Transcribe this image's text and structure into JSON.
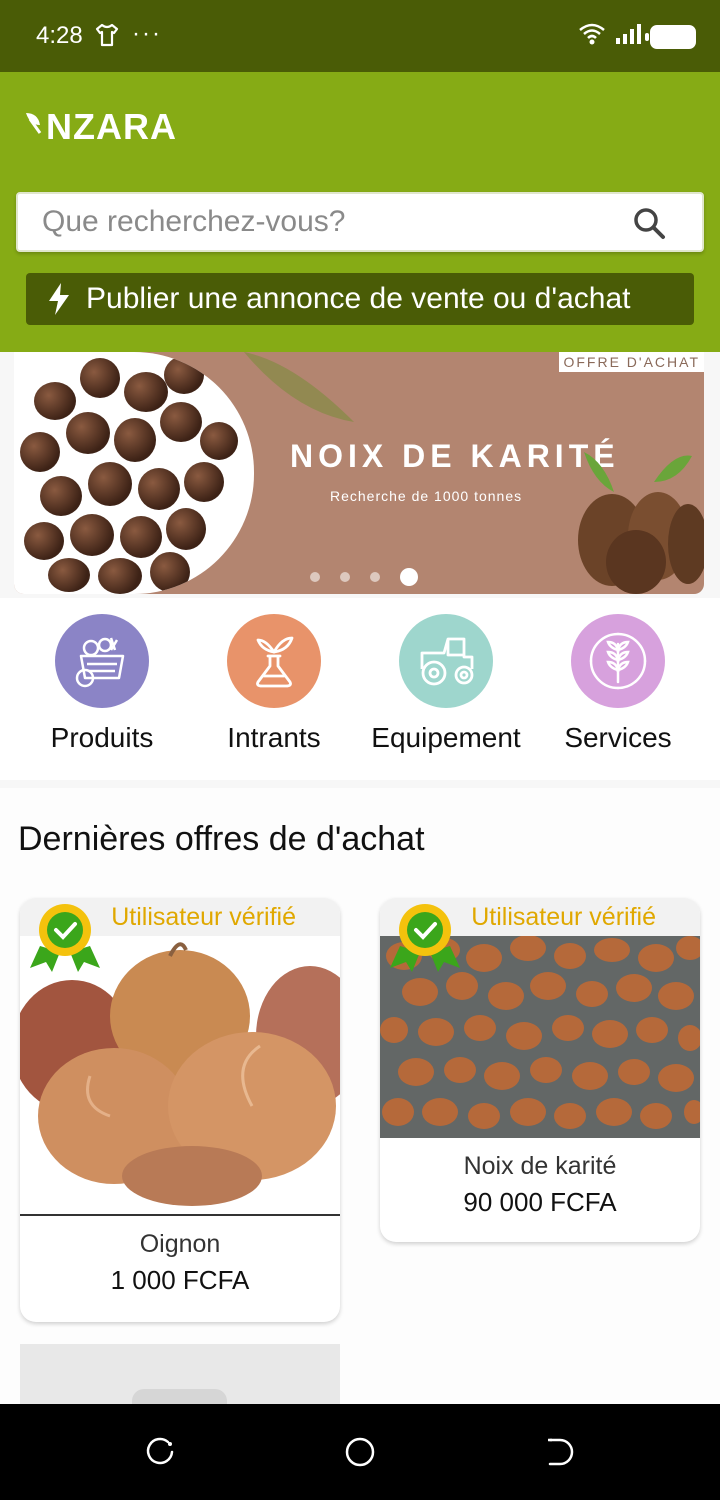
{
  "status_bar": {
    "time": "4:28",
    "more": "···"
  },
  "header": {
    "logo": "NZARA",
    "search_placeholder": "Que recherchez-vous?",
    "publish_label": "Publier une annonce de vente ou d'achat"
  },
  "banner": {
    "tag": "OFFRE D'ACHAT",
    "title": "NOIX DE KARITÉ",
    "subtitle": "Recherche de 1000 tonnes",
    "slide_count": 4,
    "active_slide": 4
  },
  "categories": [
    {
      "label": "Produits",
      "color": "#8b84c6",
      "icon": "produce-basket-icon"
    },
    {
      "label": "Intrants",
      "color": "#e8936a",
      "icon": "flask-sprout-icon"
    },
    {
      "label": "Equipement",
      "color": "#9ed6cd",
      "icon": "tractor-icon"
    },
    {
      "label": "Services",
      "color": "#d7a1dd",
      "icon": "wheat-cycle-icon"
    }
  ],
  "offers": {
    "title": "Dernières offres de d'achat",
    "items": [
      {
        "badge": "Utilisateur vérifié",
        "name": "Oignon",
        "price": "1 000 FCFA",
        "image": "onions"
      },
      {
        "badge": "Utilisateur vérifié",
        "name": "Noix de karité",
        "price": "90 000 FCFA",
        "image": "shea-nuts"
      }
    ]
  },
  "colors": {
    "status_bar": "#4a5c06",
    "header": "#86ab15",
    "publish_button": "#4a5c06",
    "verified_text": "#e0a800"
  }
}
